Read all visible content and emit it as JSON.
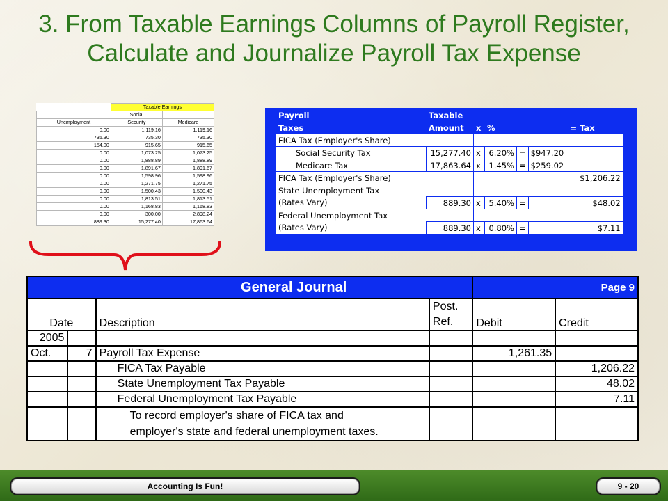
{
  "title": {
    "line1": "3. From Taxable Earnings Columns of Payroll Register,",
    "line2": "Calculate and Journalize Payroll Tax Expense"
  },
  "taxable_earnings": {
    "header": "Taxable Earnings",
    "columns": [
      "Unemployment",
      "Social Security",
      "Medicare"
    ],
    "col2_line1": "Social",
    "col2_line2": "Security",
    "rows": [
      [
        "0.00",
        "1,119.16",
        "1,119.16"
      ],
      [
        "735.30",
        "735.30",
        "735.30"
      ],
      [
        "154.00",
        "915.65",
        "915.65"
      ],
      [
        "0.00",
        "1,073.25",
        "1,073.25"
      ],
      [
        "0.00",
        "1,888.89",
        "1,888.89"
      ],
      [
        "0.00",
        "1,891.67",
        "1,891.67"
      ],
      [
        "0.00",
        "1,598.96",
        "1,598.96"
      ],
      [
        "0.00",
        "1,271.75",
        "1,271.75"
      ],
      [
        "0.00",
        "1,500.43",
        "1,500.43"
      ],
      [
        "0.00",
        "1,813.51",
        "1,813.51"
      ],
      [
        "0.00",
        "1,168.83",
        "1,168.83"
      ],
      [
        "0.00",
        "300.00",
        "2,898.24"
      ]
    ],
    "totals": [
      "889.30",
      "15,277.40",
      "17,863.64"
    ]
  },
  "payroll_taxes": {
    "header": {
      "c1a": "Payroll",
      "c1b": "Taxes",
      "c2a": "Taxable",
      "c2b": "Amount",
      "x": "x",
      "pct": "%",
      "eqtax": "= Tax"
    },
    "fica_heading": "FICA Tax (Employer's Share)",
    "ss_label": "Social Security Tax",
    "ss_amount": "15,277.40",
    "ss_x": "x",
    "ss_rate": "6.20%",
    "ss_eq": "=",
    "ss_tax": "$947.20",
    "med_label": "Medicare Tax",
    "med_amount": "17,863.64",
    "med_x": "x",
    "med_rate": "1.45%",
    "med_eq": "=",
    "med_tax": "$259.02",
    "fica_total_label": "FICA Tax (Employer's Share)",
    "fica_total": "$1,206.22",
    "state_label1": "State Unemployment Tax",
    "state_label2": "(Rates Vary)",
    "state_amount": "889.30",
    "state_x": "x",
    "state_rate": "5.40%",
    "state_eq": "=",
    "state_tax": "$48.02",
    "fed_label1": "Federal Unemployment Tax",
    "fed_label2": "(Rates Vary)",
    "fed_amount": "889.30",
    "fed_x": "x",
    "fed_rate": "0.80%",
    "fed_eq": "=",
    "fed_tax": "$7.11"
  },
  "journal": {
    "title": "General Journal",
    "page": "Page 9",
    "headers": {
      "date": "Date",
      "description": "Description",
      "post1": "Post.",
      "post2": "Ref.",
      "debit": "Debit",
      "credit": "Credit"
    },
    "year": "2005",
    "month": "Oct.",
    "day": "7",
    "entries": [
      {
        "desc": "Payroll Tax Expense",
        "debit": "1,261.35",
        "credit": ""
      },
      {
        "desc": "FICA Tax Payable",
        "debit": "",
        "credit": "1,206.22"
      },
      {
        "desc": "State Unemployment Tax Payable",
        "debit": "",
        "credit": "48.02"
      },
      {
        "desc": "Federal Unemployment Tax Payable",
        "debit": "",
        "credit": "7.11"
      }
    ],
    "memo_line1": "To record employer's share of FICA tax and",
    "memo_line2": "employer's state and federal unemployment taxes."
  },
  "footer": {
    "left": "Accounting Is Fun!",
    "right": "9 - 20"
  }
}
